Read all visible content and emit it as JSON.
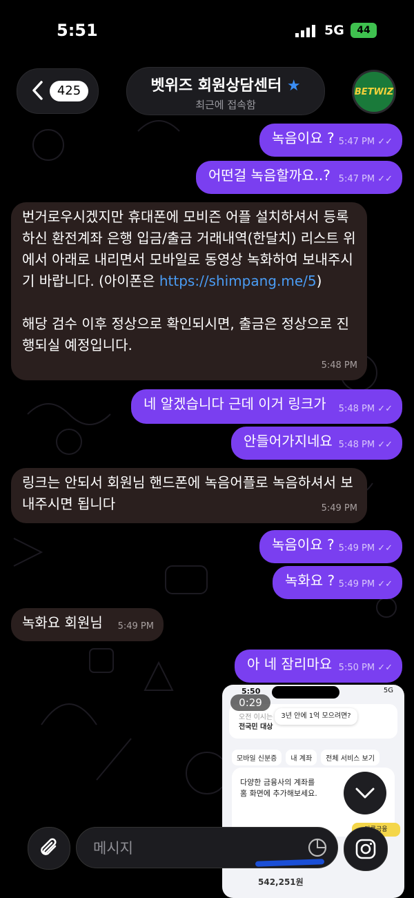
{
  "status": {
    "time": "5:51",
    "network": "5G",
    "battery": "44"
  },
  "header": {
    "back_count": "425",
    "title": "벳위즈 회원상담센터",
    "subtitle": "최근에 접속함",
    "avatar_text": "BETWIZ"
  },
  "messages": [
    {
      "dir": "out",
      "text": "녹음이요 ?",
      "time": "5:47 PM"
    },
    {
      "dir": "out",
      "text": "어떤걸 녹음할까요..?",
      "time": "5:47 PM"
    },
    {
      "dir": "in",
      "text": "번거로우시겠지만 휴대폰에 모비즌 어플 설치하셔서 등록하신 환전계좌 은행 입금/출금 거래내역(한달치) 리스트 위에서 아래로 내리면서 모바일로 동영상 녹화하여 보내주시기 바랍니다. (아이폰은 ",
      "link": "https://shimpang.me/5",
      "text_after": ")",
      "text2": "해당 검수 이후 정상으로 확인되시면, 출금은 정상으로 진행되실 예정입니다.",
      "time": "5:48 PM"
    },
    {
      "dir": "out",
      "text": "네 알겠습니다 근데 이거 링크가",
      "time": "5:48 PM"
    },
    {
      "dir": "out",
      "text": "안들어가지네요",
      "time": "5:48 PM"
    },
    {
      "dir": "in",
      "text": "링크는 안되서 회원님 핸드폰에 녹음어플로 녹음하셔서 보내주시면 됩니다",
      "time": "5:49 PM"
    },
    {
      "dir": "out",
      "text": "녹음이요 ?",
      "time": "5:49 PM"
    },
    {
      "dir": "out",
      "text": "녹화요 ?",
      "time": "5:49 PM"
    },
    {
      "dir": "in",
      "text": "녹화요 회원님",
      "time": "5:49 PM"
    },
    {
      "dir": "out",
      "text": "아 네 잠리마요",
      "time": "5:50 PM"
    }
  ],
  "video": {
    "duration": "0:29",
    "inner_time": "5:50",
    "inner_net": "5G",
    "banner_line1": "오전 이시는",
    "banner_line2": "전국민 대상",
    "banner_popup": "3년 안에 1억 모으려면?",
    "tabs": [
      "모바일 신분증",
      "내 계좌",
      "전체 서비스 보기"
    ],
    "card_text": "다양한 금융사의 계좌를\n홈 화면에 추가해보세요.",
    "pill": "다른금융",
    "amount": "542,251원"
  },
  "composer": {
    "placeholder": "메시지"
  }
}
